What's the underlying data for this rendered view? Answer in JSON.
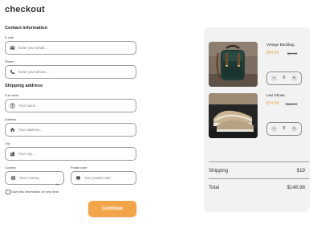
{
  "page": {
    "title": "checkout"
  },
  "contact": {
    "title": "Contact information",
    "email": {
      "label": "E-mail",
      "placeholder": "Enter your email...",
      "icon": "mail-icon"
    },
    "phone": {
      "label": "Phone",
      "placeholder": "Enter your phone...",
      "icon": "phone-icon"
    }
  },
  "shipping": {
    "title": "Shipping address",
    "full_name": {
      "label": "Full name",
      "placeholder": "Your name...",
      "icon": "user-icon"
    },
    "address": {
      "label": "Address",
      "placeholder": "Your address...",
      "icon": "home-icon"
    },
    "city": {
      "label": "City",
      "placeholder": "Your city...",
      "icon": "building-icon"
    },
    "country": {
      "label": "Country",
      "selected": "Your country..",
      "icon": "globe-icon"
    },
    "postal": {
      "label": "Postal code",
      "placeholder": "Your postal code...",
      "icon": "mailbox-icon"
    },
    "save_label": "Save this information for next time"
  },
  "actions": {
    "continue_label": "Continue"
  },
  "cart": {
    "items": [
      {
        "name": "Vintage Backbag",
        "price": "$54.99",
        "old_price": "$94.99",
        "qty": "0",
        "image": "backpack-image"
      },
      {
        "name": "Levi Shoes",
        "price": "$74.99",
        "old_price": "$124.99",
        "qty": "0",
        "image": "shoes-image"
      }
    ],
    "shipping_label": "Shipping",
    "shipping_value": "$19",
    "total_label": "Total",
    "total_value": "$148.98"
  },
  "colors": {
    "accent": "#f3a54a",
    "panel": "#f2f2f2",
    "border": "#9c9c9c"
  }
}
